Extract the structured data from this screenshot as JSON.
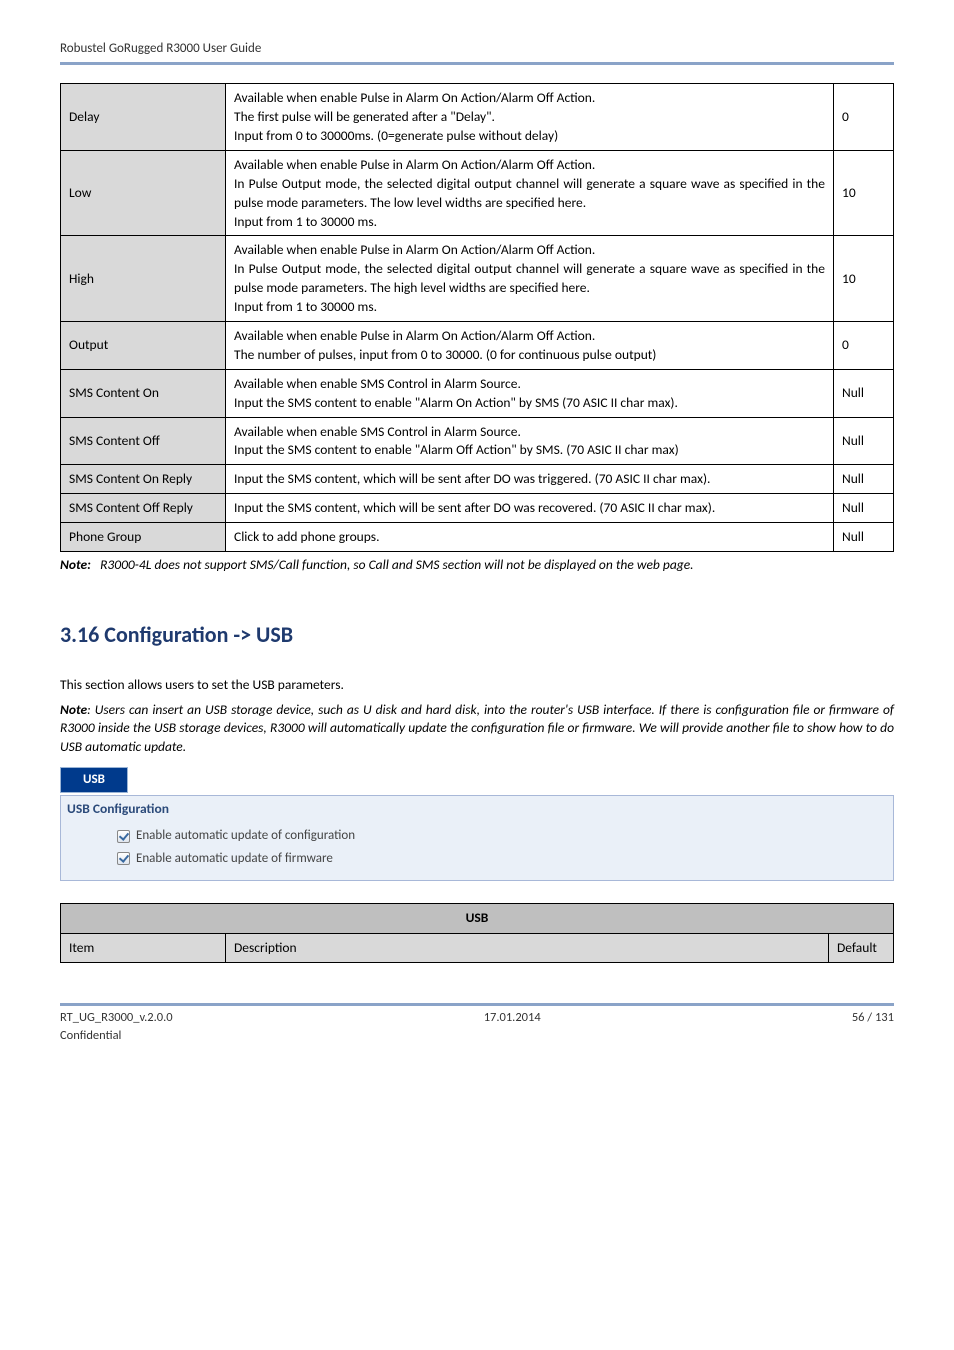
{
  "header_text": "Robustel GoRugged R3000 User Guide",
  "main_table": {
    "rows": [
      {
        "label": "Delay",
        "desc": "Available when enable Pulse in Alarm On Action/Alarm Off Action.\nThe first pulse will be generated after a \"Delay\".\nInput from 0 to 30000ms. (0=generate pulse without delay)",
        "def": "0"
      },
      {
        "label": "Low",
        "desc": "Available when enable Pulse in Alarm On Action/Alarm Off Action.\nIn Pulse Output mode, the selected digital output channel will generate a square wave as specified in the pulse mode parameters. The low level widths are specified here.\nInput from 1 to 30000 ms.",
        "def": "10"
      },
      {
        "label": "High",
        "desc": "Available when enable Pulse in Alarm On Action/Alarm Off Action.\nIn Pulse Output mode, the selected digital output channel will generate a square wave as specified in the pulse mode parameters. The high level widths are specified here.\nInput from 1 to 30000 ms.",
        "def": "10"
      },
      {
        "label": "Output",
        "desc": "Available when enable Pulse in Alarm On Action/Alarm Off Action.\nThe number of pulses, input from 0 to 30000. (0 for continuous pulse output)",
        "def": "0"
      },
      {
        "label": "SMS Content On",
        "desc": "Available when enable SMS Control in Alarm Source.\nInput the SMS content to enable \"Alarm On Action\" by SMS (70 ASIC II char max).",
        "def": "Null"
      },
      {
        "label": "SMS Content Off",
        "desc": "Available when enable SMS Control in Alarm Source.\nInput the SMS content to enable \"Alarm Off Action\" by SMS. (70 ASIC II char max)",
        "def": "Null"
      },
      {
        "label": "SMS Content On Reply",
        "desc": "Input the SMS content, which will be sent after DO was triggered. (70 ASIC II char max).",
        "def": "Null"
      },
      {
        "label": "SMS Content Off Reply",
        "desc": "Input the SMS content, which will be sent after DO was recovered. (70 ASIC II char max).",
        "def": "Null"
      },
      {
        "label": "Phone Group",
        "desc": "Click to add phone groups.",
        "def": "Null"
      }
    ]
  },
  "note": {
    "bold": "Note:",
    "text": "R3000-4L does not support SMS/Call function, so Call and SMS section will not be displayed on the web page."
  },
  "section_heading": "3.16  Configuration -> USB",
  "para1": "This section allows users to set the USB parameters.",
  "para2_bold": "Note",
  "para2_text": ": Users can insert an USB storage device, such as U disk and hard disk, into the router's USB interface. If there is configuration file or firmware of R3000 inside the USB storage devices, R3000 will automatically update the configuration file or firmware. We will provide another file to show how to do USB automatic update.",
  "usb_tab": "USB",
  "usb_config_title": "USB Configuration",
  "cb1": "Enable automatic update of configuration",
  "cb2": "Enable automatic update of firmware",
  "usb_table": {
    "header": "USB",
    "item": "Item",
    "desc": "Description",
    "def": "Default"
  },
  "footer": {
    "left1": "RT_UG_R3000_v.2.0.0",
    "left2": "Confidential",
    "center": "17.01.2014",
    "right": "56 / 131"
  }
}
